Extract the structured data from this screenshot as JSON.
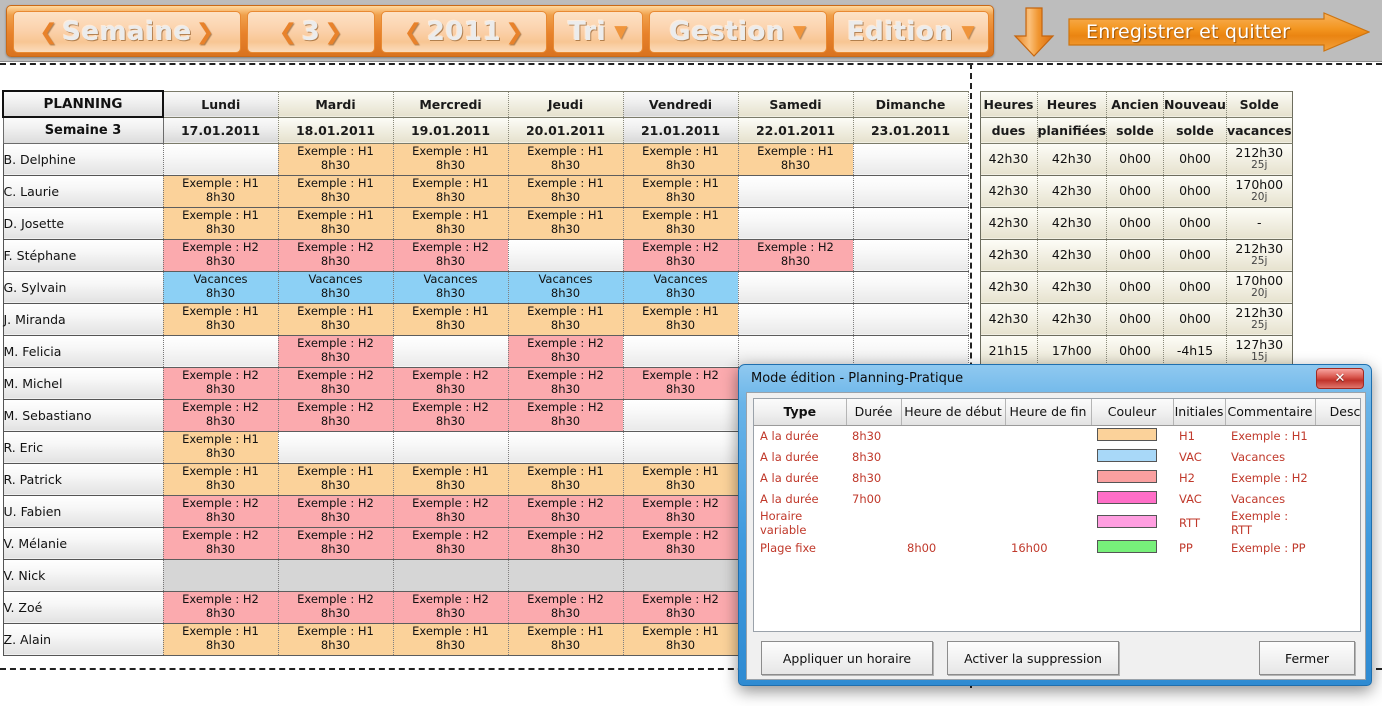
{
  "toolbar": {
    "week_label": "Semaine",
    "week_number": "3",
    "year": "2011",
    "sort_label": "Tri",
    "manage_label": "Gestion",
    "edit_label": "Edition",
    "save_quit_label": "Enregistrer et quitter",
    "prev_arrow": "❮",
    "next_arrow": "❯",
    "caret": "▼",
    "accent": "#e8822b"
  },
  "grid": {
    "title": "PLANNING",
    "subtitle": "Semaine 3",
    "day_headers": [
      "Lundi",
      "Mardi",
      "Mercredi",
      "Jeudi",
      "Vendredi",
      "Samedi",
      "Dimanche"
    ],
    "day_dates": [
      "17.01.2011",
      "18.01.2011",
      "19.01.2011",
      "20.01.2011",
      "21.01.2011",
      "22.01.2011",
      "23.01.2011"
    ],
    "num_headers_top": [
      "Heures",
      "Heures",
      "Ancien",
      "Nouveau",
      "Solde"
    ],
    "num_headers_bottom": [
      "dues",
      "planifiées",
      "solde",
      "solde",
      "vacances"
    ],
    "legend_colors": {
      "h1": "#fbd29a",
      "h2": "#fbaaae",
      "vac": "#8cd0f5",
      "gray": "#d6d6d6"
    },
    "rows": [
      {
        "name": "B. Delphine",
        "days": [
          {
            "t": "",
            "s": "",
            "c": "none"
          },
          {
            "t": "Exemple : H1",
            "s": "8h30",
            "c": "h1"
          },
          {
            "t": "Exemple : H1",
            "s": "8h30",
            "c": "h1"
          },
          {
            "t": "Exemple : H1",
            "s": "8h30",
            "c": "h1"
          },
          {
            "t": "Exemple : H1",
            "s": "8h30",
            "c": "h1"
          },
          {
            "t": "Exemple : H1",
            "s": "8h30",
            "c": "h1"
          },
          {
            "t": "",
            "s": "",
            "c": "none"
          }
        ],
        "nums": [
          "42h30",
          "42h30",
          "0h00",
          "0h00"
        ],
        "solde": "212h30",
        "solde_sub": "25j"
      },
      {
        "name": "C. Laurie",
        "days": [
          {
            "t": "Exemple : H1",
            "s": "8h30",
            "c": "h1"
          },
          {
            "t": "Exemple : H1",
            "s": "8h30",
            "c": "h1"
          },
          {
            "t": "Exemple : H1",
            "s": "8h30",
            "c": "h1"
          },
          {
            "t": "Exemple : H1",
            "s": "8h30",
            "c": "h1"
          },
          {
            "t": "Exemple : H1",
            "s": "8h30",
            "c": "h1"
          },
          {
            "t": "",
            "s": "",
            "c": "none"
          },
          {
            "t": "",
            "s": "",
            "c": "none"
          }
        ],
        "nums": [
          "42h30",
          "42h30",
          "0h00",
          "0h00"
        ],
        "solde": "170h00",
        "solde_sub": "20j"
      },
      {
        "name": "D. Josette",
        "days": [
          {
            "t": "Exemple : H1",
            "s": "8h30",
            "c": "h1"
          },
          {
            "t": "Exemple : H1",
            "s": "8h30",
            "c": "h1"
          },
          {
            "t": "Exemple : H1",
            "s": "8h30",
            "c": "h1"
          },
          {
            "t": "Exemple : H1",
            "s": "8h30",
            "c": "h1"
          },
          {
            "t": "Exemple : H1",
            "s": "8h30",
            "c": "h1"
          },
          {
            "t": "",
            "s": "",
            "c": "none"
          },
          {
            "t": "",
            "s": "",
            "c": "none"
          }
        ],
        "nums": [
          "42h30",
          "42h30",
          "0h00",
          "0h00"
        ],
        "solde": "-",
        "solde_sub": ""
      },
      {
        "name": "F. Stéphane",
        "days": [
          {
            "t": "Exemple : H2",
            "s": "8h30",
            "c": "h2"
          },
          {
            "t": "Exemple : H2",
            "s": "8h30",
            "c": "h2"
          },
          {
            "t": "Exemple : H2",
            "s": "8h30",
            "c": "h2"
          },
          {
            "t": "",
            "s": "",
            "c": "none"
          },
          {
            "t": "Exemple : H2",
            "s": "8h30",
            "c": "h2"
          },
          {
            "t": "Exemple : H2",
            "s": "8h30",
            "c": "h2"
          },
          {
            "t": "",
            "s": "",
            "c": "none"
          }
        ],
        "nums": [
          "42h30",
          "42h30",
          "0h00",
          "0h00"
        ],
        "solde": "212h30",
        "solde_sub": "25j"
      },
      {
        "name": "G. Sylvain",
        "days": [
          {
            "t": "Vacances",
            "s": "8h30",
            "c": "vac"
          },
          {
            "t": "Vacances",
            "s": "8h30",
            "c": "vac"
          },
          {
            "t": "Vacances",
            "s": "8h30",
            "c": "vac"
          },
          {
            "t": "Vacances",
            "s": "8h30",
            "c": "vac"
          },
          {
            "t": "Vacances",
            "s": "8h30",
            "c": "vac"
          },
          {
            "t": "",
            "s": "",
            "c": "none"
          },
          {
            "t": "",
            "s": "",
            "c": "none"
          }
        ],
        "nums": [
          "42h30",
          "42h30",
          "0h00",
          "0h00"
        ],
        "solde": "170h00",
        "solde_sub": "20j"
      },
      {
        "name": "J. Miranda",
        "days": [
          {
            "t": "Exemple : H1",
            "s": "8h30",
            "c": "h1"
          },
          {
            "t": "Exemple : H1",
            "s": "8h30",
            "c": "h1"
          },
          {
            "t": "Exemple : H1",
            "s": "8h30",
            "c": "h1"
          },
          {
            "t": "Exemple : H1",
            "s": "8h30",
            "c": "h1"
          },
          {
            "t": "Exemple : H1",
            "s": "8h30",
            "c": "h1"
          },
          {
            "t": "",
            "s": "",
            "c": "none"
          },
          {
            "t": "",
            "s": "",
            "c": "none"
          }
        ],
        "nums": [
          "42h30",
          "42h30",
          "0h00",
          "0h00"
        ],
        "solde": "212h30",
        "solde_sub": "25j"
      },
      {
        "name": "M. Felicia",
        "days": [
          {
            "t": "",
            "s": "",
            "c": "none"
          },
          {
            "t": "Exemple : H2",
            "s": "8h30",
            "c": "h2"
          },
          {
            "t": "",
            "s": "",
            "c": "none"
          },
          {
            "t": "Exemple : H2",
            "s": "8h30",
            "c": "h2"
          },
          {
            "t": "",
            "s": "",
            "c": "none"
          },
          {
            "t": "",
            "s": "",
            "c": "none"
          },
          {
            "t": "",
            "s": "",
            "c": "none"
          }
        ],
        "nums": [
          "21h15",
          "17h00",
          "0h00",
          "-4h15"
        ],
        "solde": "127h30",
        "solde_sub": "15j"
      },
      {
        "name": "M. Michel",
        "days": [
          {
            "t": "Exemple : H2",
            "s": "8h30",
            "c": "h2"
          },
          {
            "t": "Exemple : H2",
            "s": "8h30",
            "c": "h2"
          },
          {
            "t": "Exemple : H2",
            "s": "8h30",
            "c": "h2"
          },
          {
            "t": "Exemple : H2",
            "s": "8h30",
            "c": "h2"
          },
          {
            "t": "Exemple : H2",
            "s": "8h30",
            "c": "h2"
          },
          {
            "t": "",
            "s": "",
            "c": "none"
          },
          {
            "t": "",
            "s": "",
            "c": "none"
          }
        ],
        "nums": [
          "",
          "",
          "",
          ""
        ],
        "solde": "",
        "solde_sub": ""
      },
      {
        "name": "M. Sebastiano",
        "days": [
          {
            "t": "Exemple : H2",
            "s": "8h30",
            "c": "h2"
          },
          {
            "t": "Exemple : H2",
            "s": "8h30",
            "c": "h2"
          },
          {
            "t": "Exemple : H2",
            "s": "8h30",
            "c": "h2"
          },
          {
            "t": "Exemple : H2",
            "s": "8h30",
            "c": "h2"
          },
          {
            "t": "",
            "s": "",
            "c": "none"
          },
          {
            "t": "",
            "s": "",
            "c": "none"
          },
          {
            "t": "",
            "s": "",
            "c": "none"
          }
        ],
        "nums": [
          "",
          "",
          "",
          ""
        ],
        "solde": "",
        "solde_sub": ""
      },
      {
        "name": "R. Eric",
        "days": [
          {
            "t": "Exemple : H1",
            "s": "8h30",
            "c": "h1"
          },
          {
            "t": "",
            "s": "",
            "c": "none"
          },
          {
            "t": "",
            "s": "",
            "c": "none"
          },
          {
            "t": "",
            "s": "",
            "c": "none"
          },
          {
            "t": "",
            "s": "",
            "c": "none"
          },
          {
            "t": "",
            "s": "",
            "c": "none"
          },
          {
            "t": "",
            "s": "",
            "c": "none"
          }
        ],
        "nums": [
          "",
          "",
          "",
          ""
        ],
        "solde": "",
        "solde_sub": ""
      },
      {
        "name": "R. Patrick",
        "days": [
          {
            "t": "Exemple : H1",
            "s": "8h30",
            "c": "h1"
          },
          {
            "t": "Exemple : H1",
            "s": "8h30",
            "c": "h1"
          },
          {
            "t": "Exemple : H1",
            "s": "8h30",
            "c": "h1"
          },
          {
            "t": "Exemple : H1",
            "s": "8h30",
            "c": "h1"
          },
          {
            "t": "Exemple : H1",
            "s": "8h30",
            "c": "h1"
          },
          {
            "t": "",
            "s": "",
            "c": "none"
          },
          {
            "t": "",
            "s": "",
            "c": "none"
          }
        ],
        "nums": [
          "",
          "",
          "",
          ""
        ],
        "solde": "",
        "solde_sub": ""
      },
      {
        "name": "U. Fabien",
        "days": [
          {
            "t": "Exemple : H2",
            "s": "8h30",
            "c": "h2"
          },
          {
            "t": "Exemple : H2",
            "s": "8h30",
            "c": "h2"
          },
          {
            "t": "Exemple : H2",
            "s": "8h30",
            "c": "h2"
          },
          {
            "t": "Exemple : H2",
            "s": "8h30",
            "c": "h2"
          },
          {
            "t": "Exemple : H2",
            "s": "8h30",
            "c": "h2"
          },
          {
            "t": "",
            "s": "",
            "c": "none"
          },
          {
            "t": "",
            "s": "",
            "c": "none"
          }
        ],
        "nums": [
          "",
          "",
          "",
          ""
        ],
        "solde": "",
        "solde_sub": ""
      },
      {
        "name": "V. Mélanie",
        "days": [
          {
            "t": "Exemple : H2",
            "s": "8h30",
            "c": "h2"
          },
          {
            "t": "Exemple : H2",
            "s": "8h30",
            "c": "h2"
          },
          {
            "t": "Exemple : H2",
            "s": "8h30",
            "c": "h2"
          },
          {
            "t": "Exemple : H2",
            "s": "8h30",
            "c": "h2"
          },
          {
            "t": "Exemple : H2",
            "s": "8h30",
            "c": "h2"
          },
          {
            "t": "",
            "s": "",
            "c": "none"
          },
          {
            "t": "",
            "s": "",
            "c": "none"
          }
        ],
        "nums": [
          "",
          "",
          "",
          ""
        ],
        "solde": "",
        "solde_sub": ""
      },
      {
        "name": "V. Nick",
        "days": [
          {
            "t": "",
            "s": "",
            "c": "gray"
          },
          {
            "t": "",
            "s": "",
            "c": "gray"
          },
          {
            "t": "",
            "s": "",
            "c": "gray"
          },
          {
            "t": "",
            "s": "",
            "c": "gray"
          },
          {
            "t": "",
            "s": "",
            "c": "gray"
          },
          {
            "t": "",
            "s": "",
            "c": "none"
          },
          {
            "t": "",
            "s": "",
            "c": "none"
          }
        ],
        "nums": [
          "",
          "",
          "",
          ""
        ],
        "solde": "",
        "solde_sub": ""
      },
      {
        "name": "V. Zoé",
        "days": [
          {
            "t": "Exemple : H2",
            "s": "8h30",
            "c": "h2"
          },
          {
            "t": "Exemple : H2",
            "s": "8h30",
            "c": "h2"
          },
          {
            "t": "Exemple : H2",
            "s": "8h30",
            "c": "h2"
          },
          {
            "t": "Exemple : H2",
            "s": "8h30",
            "c": "h2"
          },
          {
            "t": "Exemple : H2",
            "s": "8h30",
            "c": "h2"
          },
          {
            "t": "",
            "s": "",
            "c": "none"
          },
          {
            "t": "",
            "s": "",
            "c": "none"
          }
        ],
        "nums": [
          "",
          "",
          "",
          ""
        ],
        "solde": "",
        "solde_sub": ""
      },
      {
        "name": "Z. Alain",
        "days": [
          {
            "t": "Exemple : H1",
            "s": "8h30",
            "c": "h1"
          },
          {
            "t": "Exemple : H1",
            "s": "8h30",
            "c": "h1"
          },
          {
            "t": "Exemple : H1",
            "s": "8h30",
            "c": "h1"
          },
          {
            "t": "Exemple : H1",
            "s": "8h30",
            "c": "h1"
          },
          {
            "t": "Exemple : H1",
            "s": "8h30",
            "c": "h1"
          },
          {
            "t": "",
            "s": "",
            "c": "none"
          },
          {
            "t": "",
            "s": "",
            "c": "none"
          }
        ],
        "nums": [
          "",
          "",
          "",
          ""
        ],
        "solde": "",
        "solde_sub": ""
      }
    ]
  },
  "dialog": {
    "title": "Mode édition - Planning-Pratique",
    "close_glyph": "✕",
    "columns": [
      "Type",
      "Durée",
      "Heure de début",
      "Heure de fin",
      "Couleur",
      "Initiales",
      "Commentaire",
      "Description"
    ],
    "rows": [
      {
        "type": "A la durée",
        "duree": "8h30",
        "debut": "",
        "fin": "",
        "color": "#fbd29a",
        "initiales": "H1",
        "commentaire": "Exemple : H1",
        "description": ""
      },
      {
        "type": "A la durée",
        "duree": "8h30",
        "debut": "",
        "fin": "",
        "color": "#a8d8f8",
        "initiales": "VAC",
        "commentaire": "Vacances",
        "description": ""
      },
      {
        "type": "A la durée",
        "duree": "8h30",
        "debut": "",
        "fin": "",
        "color": "#faa0a0",
        "initiales": "H2",
        "commentaire": "Exemple : H2",
        "description": ""
      },
      {
        "type": "A la durée",
        "duree": "7h00",
        "debut": "",
        "fin": "",
        "color": "#ff6ec7",
        "initiales": "VAC",
        "commentaire": "Vacances",
        "description": ""
      },
      {
        "type": "Horaire variable",
        "duree": "",
        "debut": "",
        "fin": "",
        "color": "#ff9ee0",
        "initiales": "RTT",
        "commentaire": "Exemple : RTT",
        "description": ""
      },
      {
        "type": "Plage fixe",
        "duree": "",
        "debut": "8h00",
        "fin": "16h00",
        "color": "#77f07a",
        "initiales": "PP",
        "commentaire": "Exemple : PP",
        "description": ""
      }
    ],
    "buttons": {
      "apply": "Appliquer un horaire",
      "delete": "Activer la suppression",
      "close": "Fermer"
    }
  }
}
